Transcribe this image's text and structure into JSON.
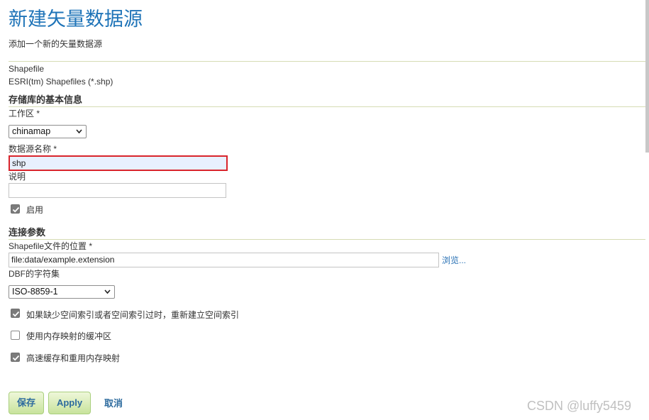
{
  "header": {
    "title": "新建矢量数据源",
    "subtitle": "添加一个新的矢量数据源"
  },
  "source": {
    "type": "Shapefile",
    "description": "ESRI(tm) Shapefiles (*.shp)"
  },
  "basic_info": {
    "heading": "存储库的基本信息",
    "workspace_label": "工作区 *",
    "workspace_value": "chinamap",
    "name_label": "数据源名称 *",
    "name_value": "shp",
    "description_label": "说明",
    "description_value": "",
    "enabled_label": "启用",
    "enabled": true
  },
  "connection": {
    "heading": "连接参数",
    "location_label": "Shapefile文件的位置 *",
    "location_value": "file:data/example.extension",
    "browse_label": "浏览...",
    "charset_label": "DBF的字符集",
    "charset_value": "ISO-8859-1",
    "options": [
      {
        "label": "如果缺少空间索引或者空间索引过时，重新建立空间索引",
        "checked": true
      },
      {
        "label": "使用内存映射的缓冲区",
        "checked": false
      },
      {
        "label": "高速缓存和重用内存映射",
        "checked": true
      }
    ]
  },
  "actions": {
    "save_label": "保存",
    "apply_label": "Apply",
    "cancel_label": "取消"
  },
  "watermark": "CSDN @luffy5459",
  "colors": {
    "title": "#1f74b8",
    "highlight_border": "#d9242c",
    "highlight_fill": "#e8f0fe",
    "button_gradient_top": "#eef7d9",
    "button_gradient_bottom": "#c8e39c"
  },
  "icons": {
    "dropdown": "chevron-down-icon",
    "checkbox_checked": "checkmark-icon"
  }
}
